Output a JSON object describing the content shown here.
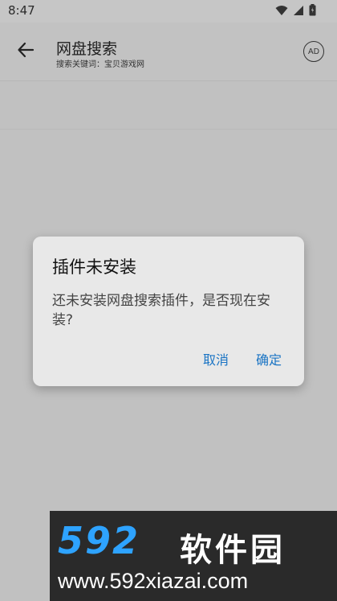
{
  "status_bar": {
    "time": "8:47",
    "icons": [
      "wifi-icon",
      "signal-icon",
      "battery-icon"
    ]
  },
  "app_bar": {
    "title": "网盘搜索",
    "subtitle": "搜索关键词：宝贝游戏网",
    "ad_label": "AD"
  },
  "dialog": {
    "title": "插件未安装",
    "message": "还未安装网盘搜索插件，是否现在安装?",
    "cancel_label": "取消",
    "confirm_label": "确定"
  },
  "watermark": {
    "brand_number": "592",
    "brand_text": "软件园",
    "url": "www.592xiazai.com"
  },
  "colors": {
    "accent": "#1a74c4",
    "scrim": "#c1c1c1",
    "dialog_bg": "#e8e8e8",
    "watermark_bg": "#2a2a2a",
    "watermark_blue": "#2ea3ff"
  }
}
